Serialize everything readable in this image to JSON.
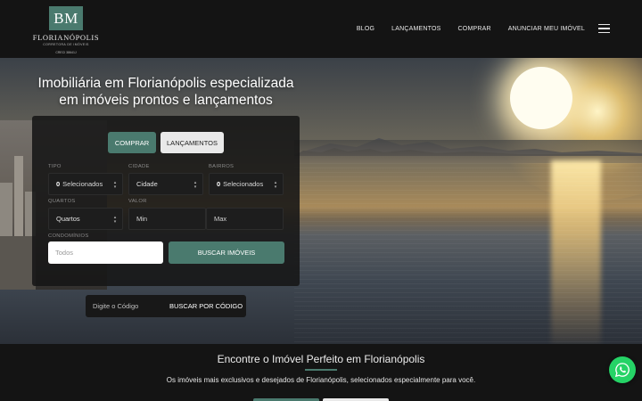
{
  "header": {
    "logo": {
      "mark": "BM",
      "name": "FLORIANÓPOLIS",
      "subtitle": "CORRETORA DE IMÓVEIS",
      "creci": "CRECI 38641J"
    },
    "nav": [
      "BLOG",
      "LANÇAMENTOS",
      "COMPRAR",
      "ANUNCIAR MEU IMÓVEL"
    ]
  },
  "hero": {
    "title_line1": "Imobiliária em Florianópolis especializada",
    "title_line2": "em imóveis prontos e lançamentos"
  },
  "search": {
    "tabs": {
      "comprar": "COMPRAR",
      "lancamentos": "LANÇAMENTOS"
    },
    "labels": {
      "tipo": "TIPO",
      "cidade": "CIDADE",
      "bairros": "BAIRROS",
      "quartos": "QUARTOS",
      "valor": "VALOR",
      "condominios": "CONDOMÍNIOS"
    },
    "tipo": {
      "count": "0",
      "text": "Selecionados"
    },
    "cidade": "Cidade",
    "bairros": {
      "count": "0",
      "text": "Selecionados"
    },
    "quartos": "Quartos",
    "valor_min_placeholder": "Min",
    "valor_max_placeholder": "Max",
    "condominios_placeholder": "Todos",
    "submit": "BUSCAR IMÓVEIS"
  },
  "code_search": {
    "placeholder": "Digite o Código",
    "button": "BUSCAR POR CÓDIGO"
  },
  "section": {
    "title": "Encontre o Imóvel Perfeito em Florianópolis",
    "subtitle": "Os imóveis mais exclusivos e desejados de Florianópolis, selecionados especialmente para você."
  },
  "colors": {
    "accent": "#4a7a6e",
    "background": "#141414",
    "whatsapp": "#25d366"
  },
  "icons": {
    "menu": "hamburger-icon",
    "whatsapp": "whatsapp-icon",
    "dropdown": "updown-caret-icon"
  }
}
